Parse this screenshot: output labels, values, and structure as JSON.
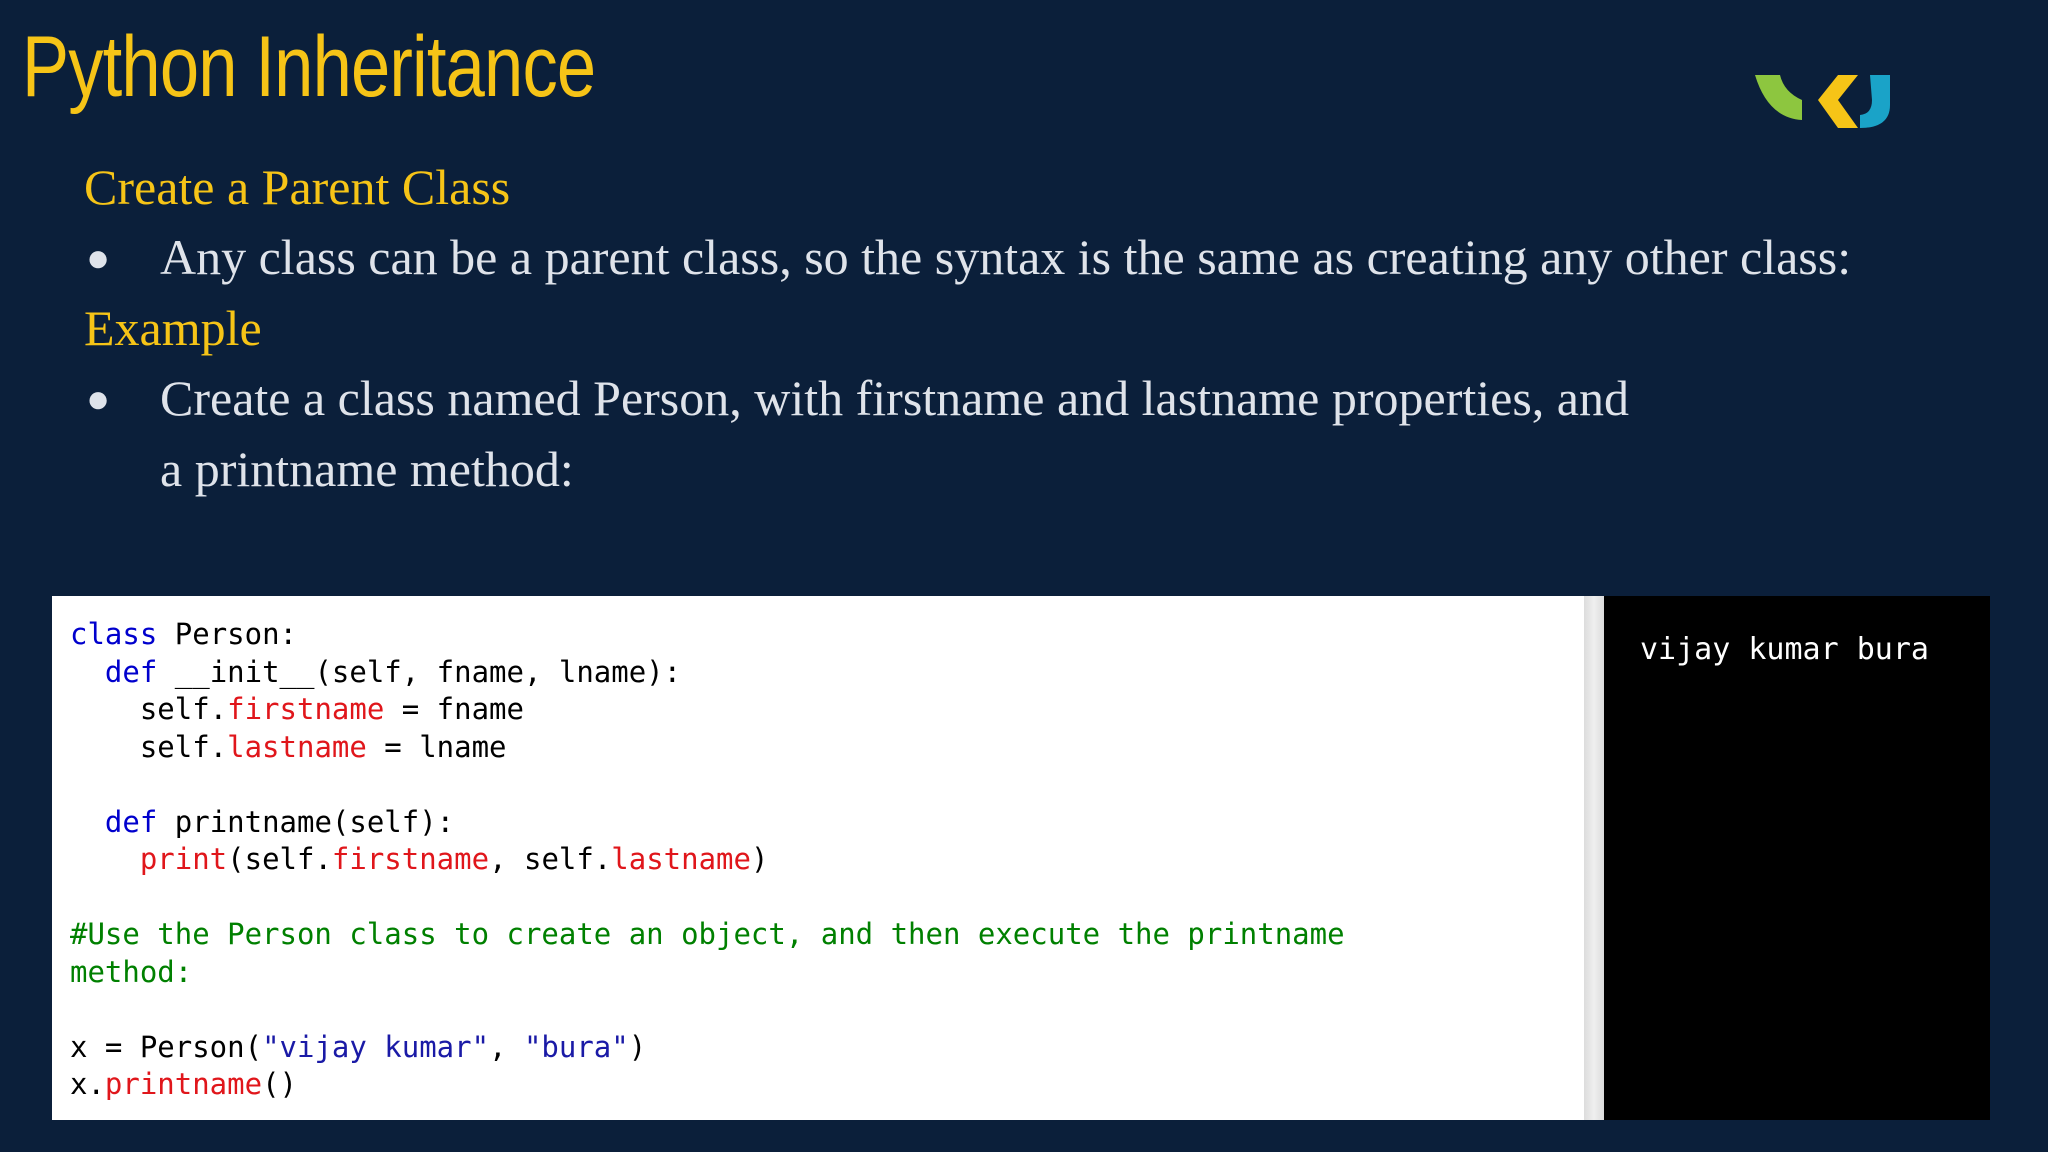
{
  "slide": {
    "title": "Python Inheritance",
    "subtitle1": "Create a Parent Class",
    "bullet1": "Any class can be a parent class, so the syntax is the same as creating any other class:",
    "subtitle2": "Example",
    "bullet2_line1": "Create a class named Person, with firstname and lastname properties, and",
    "bullet2_line2": "a printname method:",
    "bullet_glyph": "●"
  },
  "code": {
    "l1_kw": "class",
    "l1_rest": " Person:",
    "l2_indent": "  ",
    "l2_kw": "def",
    "l2_rest": " __init__(self, fname, lname):",
    "l3_a": "    self.",
    "l3_attr": "firstname",
    "l3_b": " = fname",
    "l4_a": "    self.",
    "l4_attr": "lastname",
    "l4_b": " = lname",
    "l6_indent": "  ",
    "l6_kw": "def",
    "l6_rest": " printname(self):",
    "l7_indent": "    ",
    "l7_fn": "print",
    "l7_a": "(self.",
    "l7_attr1": "firstname",
    "l7_b": ", self.",
    "l7_attr2": "lastname",
    "l7_c": ")",
    "comment1": "#Use the Person class to create an object, and then execute the printname",
    "comment2": "method:",
    "l12_a": "x = Person(",
    "l12_s1": "\"vijay kumar\"",
    "l12_b": ", ",
    "l12_s2": "\"bura\"",
    "l12_c": ")",
    "l13_a": "x.",
    "l13_fn": "printname",
    "l13_b": "()"
  },
  "output": {
    "text": "vijay kumar bura"
  },
  "colors": {
    "background": "#0b1f3a",
    "title": "#f6c417",
    "body_text": "#dfe3ea",
    "keyword": "#0000cd",
    "attribute": "#e0161b",
    "comment": "#008000",
    "logo_green": "#8dc63f",
    "logo_yellow": "#f6c417",
    "logo_teal": "#1aa3c8"
  },
  "icons": {
    "logo": "brand-logo-icon"
  }
}
